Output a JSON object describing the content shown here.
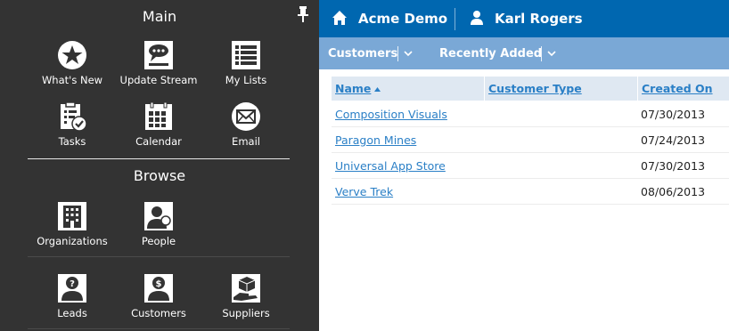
{
  "menu": {
    "main_title": "Main",
    "browse_title": "Browse",
    "main_items": [
      {
        "label": "What's New",
        "icon": "star-icon"
      },
      {
        "label": "Update Stream",
        "icon": "chat-icon"
      },
      {
        "label": "My Lists",
        "icon": "list-icon"
      },
      {
        "label": "Tasks",
        "icon": "tasks-icon"
      },
      {
        "label": "Calendar",
        "icon": "calendar-icon"
      },
      {
        "label": "Email",
        "icon": "email-icon"
      }
    ],
    "browse_items": [
      {
        "label": "Organizations",
        "icon": "building-icon"
      },
      {
        "label": "People",
        "icon": "person-icon"
      },
      {
        "label": "Leads",
        "icon": "question-person-icon"
      },
      {
        "label": "Customers",
        "icon": "dollar-person-icon"
      },
      {
        "label": "Suppliers",
        "icon": "box-hand-icon"
      }
    ]
  },
  "topbar": {
    "app_title": "Acme Demo",
    "user_name": "Karl Rogers",
    "bg_color": "#0067b0"
  },
  "subbar": {
    "entity": "Customers",
    "view": "Recently Added",
    "bg_color": "#7aa8d6"
  },
  "grid": {
    "columns": [
      "Name",
      "Customer Type",
      "Created On"
    ],
    "sort": "Name ascending",
    "rows": [
      {
        "name": "Composition Visuals",
        "type": "",
        "created": "07/30/2013"
      },
      {
        "name": "Paragon Mines",
        "type": "",
        "created": "07/24/2013"
      },
      {
        "name": "Universal App Store",
        "type": "",
        "created": "07/30/2013"
      },
      {
        "name": "Verve Trek",
        "type": "",
        "created": "08/06/2013"
      }
    ]
  }
}
